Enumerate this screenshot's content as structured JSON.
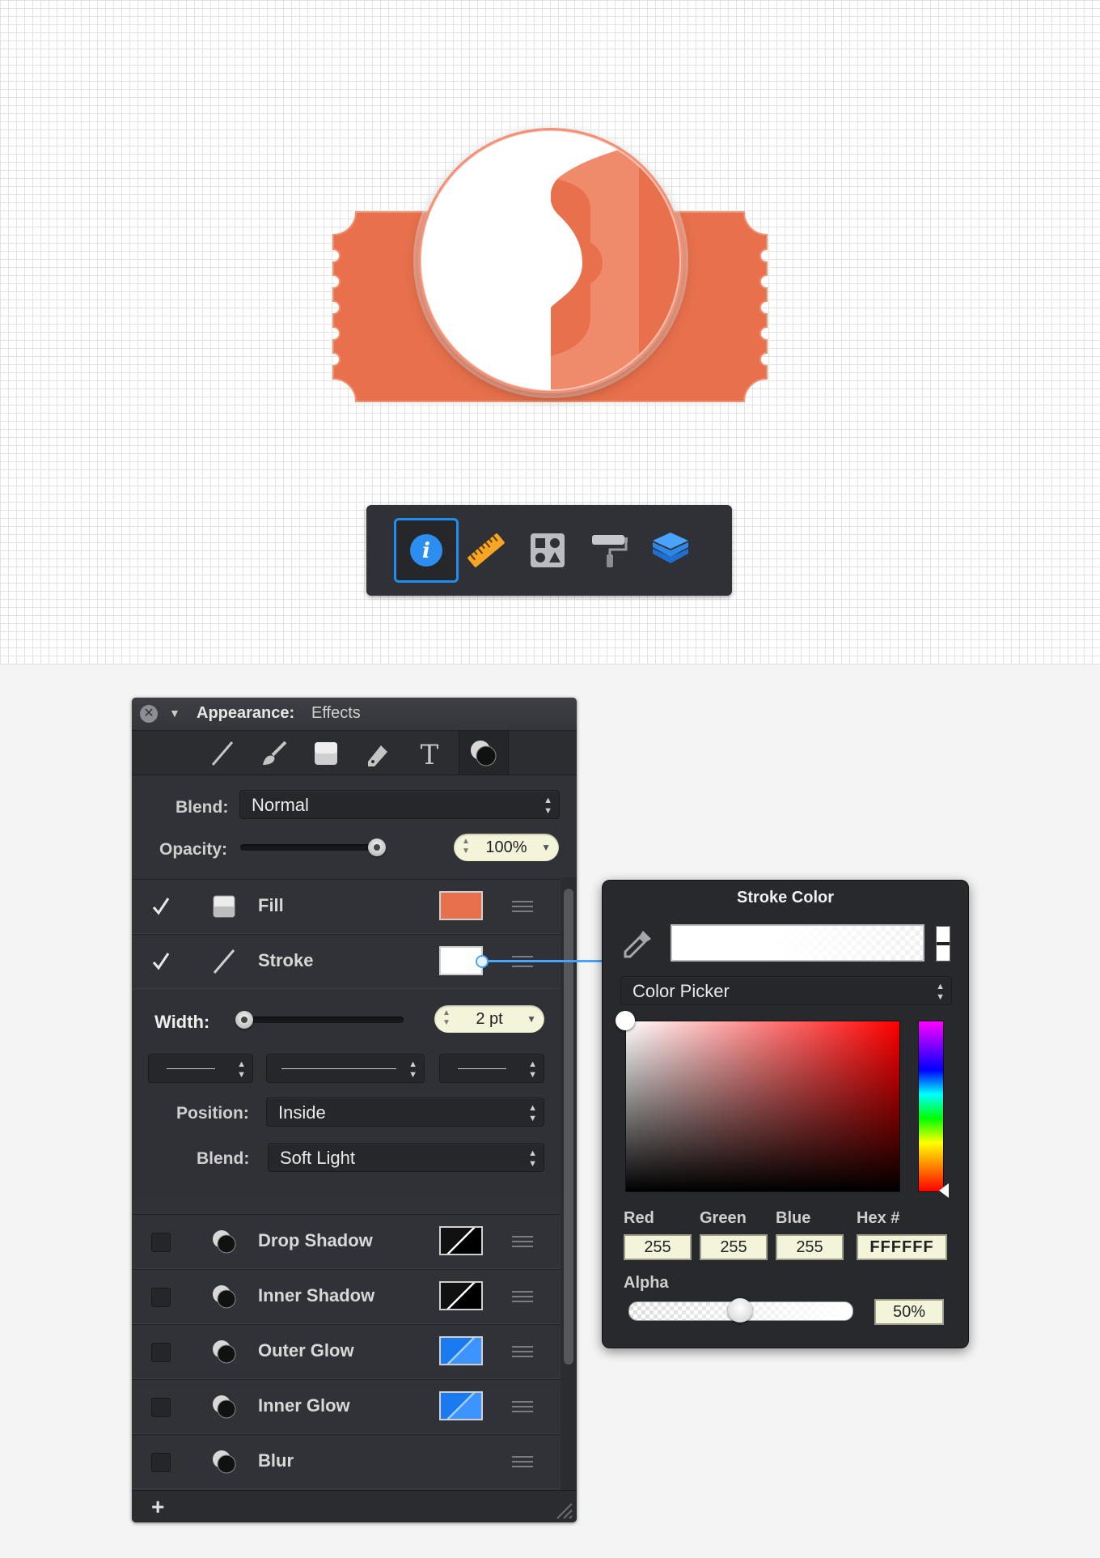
{
  "toolbar": {
    "buttons": [
      {
        "name": "info-icon",
        "active": true
      },
      {
        "name": "ruler-icon",
        "active": false
      },
      {
        "name": "symbols-icon",
        "active": false
      },
      {
        "name": "paint-roller-icon",
        "active": false
      },
      {
        "name": "layers-icon",
        "active": false
      }
    ]
  },
  "panel": {
    "title_bold": "Appearance:",
    "title_rest": "Effects",
    "tabs": [
      "stroke-tool-icon",
      "brush-icon",
      "fill-icon",
      "pen-icon",
      "text-icon",
      "effects-icon"
    ],
    "blend_label": "Blend:",
    "blend_value": "Normal",
    "opacity_label": "Opacity:",
    "opacity_value": "100%",
    "opacity_level": 1.0,
    "fill": {
      "label": "Fill",
      "checked": true,
      "color": "#e8704c"
    },
    "stroke": {
      "label": "Stroke",
      "checked": true,
      "color": "#ffffff"
    },
    "width_label": "Width:",
    "width_value": "2 pt",
    "position_label": "Position:",
    "position_value": "Inside",
    "stroke_blend_label": "Blend:",
    "stroke_blend_value": "Soft Light",
    "effects": [
      {
        "label": "Drop Shadow",
        "checked": false,
        "swatch": "black"
      },
      {
        "label": "Inner Shadow",
        "checked": false,
        "swatch": "black"
      },
      {
        "label": "Outer Glow",
        "checked": false,
        "swatch": "blue"
      },
      {
        "label": "Inner Glow",
        "checked": false,
        "swatch": "blue"
      },
      {
        "label": "Blur",
        "checked": false,
        "swatch": "none"
      }
    ],
    "add_label": "+"
  },
  "popover": {
    "title": "Stroke Color",
    "mode_value": "Color Picker",
    "red_label": "Red",
    "green_label": "Green",
    "blue_label": "Blue",
    "hex_label": "Hex #",
    "red": "255",
    "green": "255",
    "blue": "255",
    "hex": "FFFFFF",
    "alpha_label": "Alpha",
    "alpha_value": "50%",
    "alpha_level": 0.5
  },
  "colors": {
    "ticket": "#e8704c",
    "accent": "#1f8ef1",
    "panel_bg": "#303237"
  }
}
